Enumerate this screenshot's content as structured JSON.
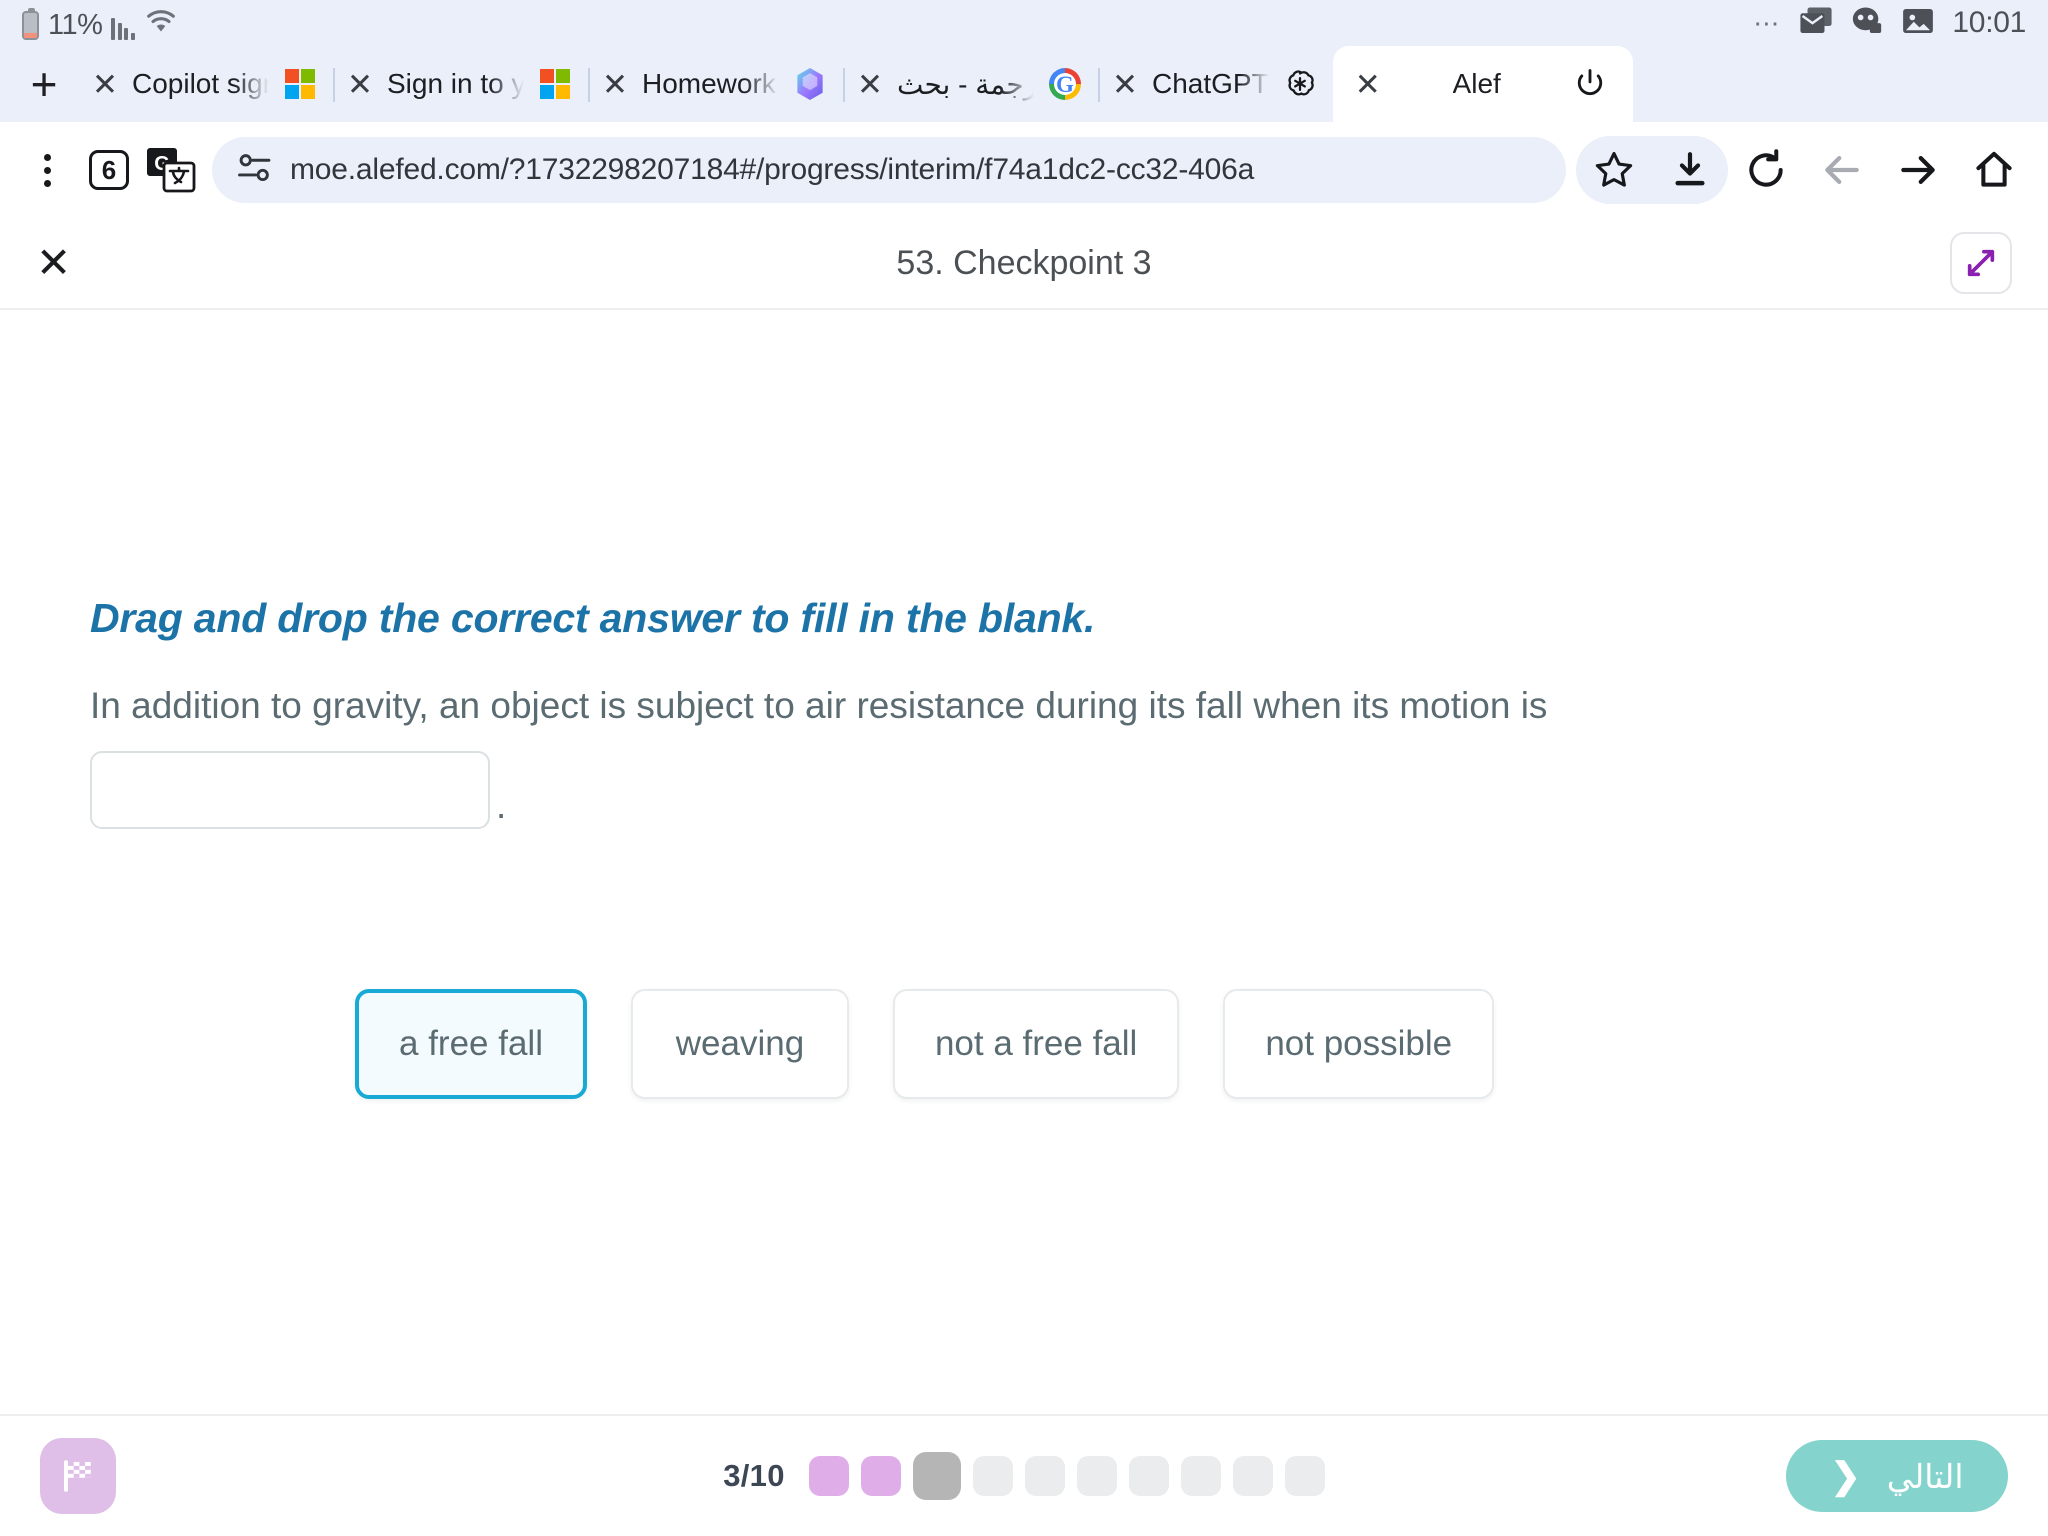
{
  "statusbar": {
    "battery_percent": "11%",
    "battery_level_pct": 11,
    "time": "10:01",
    "overflow": "⋯",
    "icons": [
      "battery-icon",
      "signal-bars-icon",
      "wifi-icon",
      "overflow-dots-icon",
      "mail-icon",
      "chat-icon",
      "image-icon"
    ]
  },
  "browser": {
    "new_tab_label": "+",
    "close_glyph": "✕",
    "tabs": [
      {
        "title": "Copilot sign-in i",
        "favicon": "microsoft-icon",
        "active": false
      },
      {
        "title": "Sign in to your M",
        "favicon": "microsoft-icon",
        "active": false
      },
      {
        "title": "Homework Spa",
        "favicon": "hexagon-icon",
        "active": false
      },
      {
        "title": "ترجمة - بحث ogle",
        "favicon": "google-icon",
        "active": false
      },
      {
        "title": "ChatGPT",
        "favicon": "openai-icon",
        "active": false
      },
      {
        "title": "Alef",
        "favicon": "alef-icon",
        "active": true
      }
    ],
    "tab_count": "6",
    "menu_icon": "kebab-menu-icon",
    "translate_icon": "google-translate-icon",
    "site_info_icon": "page-info-icon",
    "url": "moe.alefed.com/?1732298207184#/progress/interim/f74a1dc2-cc32-406a",
    "toolbar_icons": [
      "bookmark-star-icon",
      "download-icon",
      "reload-icon",
      "back-arrow-icon",
      "forward-arrow-icon",
      "home-icon"
    ]
  },
  "app_header": {
    "close_label": "✕",
    "title": "53. Checkpoint 3",
    "expand_label": "expand-icon"
  },
  "question": {
    "instruction": "Drag and drop the correct answer to fill in the blank.",
    "sentence": "In addition to gravity, an object is subject to air resistance during its fall when its motion is",
    "blank_value": "",
    "trailing_punctuation": ".",
    "options": [
      {
        "label": "a free fall",
        "selected": true
      },
      {
        "label": "weaving",
        "selected": false
      },
      {
        "label": "not a free fall",
        "selected": false
      },
      {
        "label": "not possible",
        "selected": false
      }
    ]
  },
  "footer": {
    "flag_icon": "checkered-flag-icon",
    "progress_text": "3/10",
    "progress_current": 3,
    "progress_total": 10,
    "progress_states": [
      "done",
      "done",
      "current",
      "todo",
      "todo",
      "todo",
      "todo",
      "todo",
      "todo",
      "todo"
    ],
    "next_label": "التالي",
    "next_chevron": "❯"
  },
  "colors": {
    "accent_blue": "#1c73a8",
    "selected_border": "#18a9d4",
    "next_button": "#84d4cd",
    "progress_done": "#dfaee9",
    "progress_current": "#b5b5b5",
    "flag_button": "#dfbfe8",
    "expand_purple": "#8a1fb0",
    "chrome_bg": "#eaeff9"
  }
}
